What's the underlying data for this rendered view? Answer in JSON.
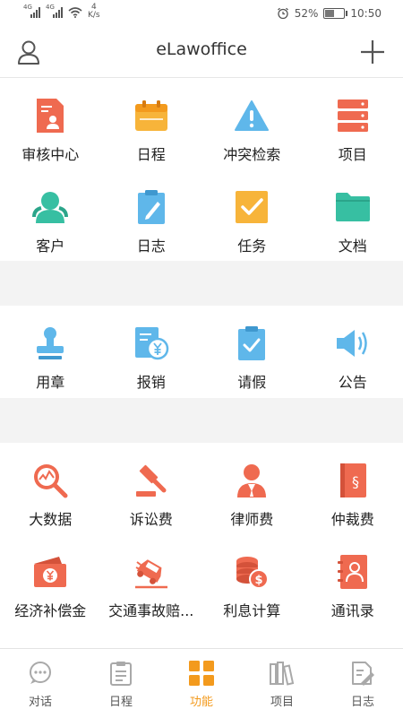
{
  "status_bar": {
    "net1": "4G",
    "net2": "4G",
    "speed_value": "4",
    "speed_unit": "K/s",
    "battery": "52%",
    "time": "10:50",
    "battery_level": 0.52
  },
  "header": {
    "title": "eLawoffice"
  },
  "sections": [
    {
      "items": [
        {
          "label": "审核中心",
          "icon": "review-document-icon"
        },
        {
          "label": "日程",
          "icon": "calendar-icon"
        },
        {
          "label": "冲突检索",
          "icon": "warning-triangle-icon"
        },
        {
          "label": "项目",
          "icon": "server-stack-icon"
        },
        {
          "label": "客户",
          "icon": "clients-icon"
        },
        {
          "label": "日志",
          "icon": "clipboard-pen-icon"
        },
        {
          "label": "任务",
          "icon": "checkbox-icon"
        },
        {
          "label": "文档",
          "icon": "folder-icon"
        }
      ]
    },
    {
      "items": [
        {
          "label": "用章",
          "icon": "stamp-icon"
        },
        {
          "label": "报销",
          "icon": "reimburse-yen-icon"
        },
        {
          "label": "请假",
          "icon": "leave-clipboard-icon"
        },
        {
          "label": "公告",
          "icon": "speaker-icon"
        }
      ]
    },
    {
      "items": [
        {
          "label": "大数据",
          "icon": "data-search-icon"
        },
        {
          "label": "诉讼费",
          "icon": "gavel-icon"
        },
        {
          "label": "律师费",
          "icon": "lawyer-icon"
        },
        {
          "label": "仲裁费",
          "icon": "law-book-icon"
        },
        {
          "label": "经济补偿金",
          "icon": "money-wallet-icon"
        },
        {
          "label": "交通事故赔...",
          "icon": "car-accident-icon"
        },
        {
          "label": "利息计算",
          "icon": "coins-icon"
        },
        {
          "label": "通讯录",
          "icon": "address-book-icon"
        }
      ]
    }
  ],
  "tabs": [
    {
      "label": "对话",
      "icon": "chat-bubble-icon",
      "active": false
    },
    {
      "label": "日程",
      "icon": "schedule-icon",
      "active": false
    },
    {
      "label": "功能",
      "icon": "grid-icon",
      "active": true
    },
    {
      "label": "项目",
      "icon": "books-icon",
      "active": false
    },
    {
      "label": "日志",
      "icon": "log-icon",
      "active": false
    }
  ],
  "colors": {
    "accent": "#f39a1d",
    "red": "#ef6a50",
    "yellow": "#f7b43a",
    "teal": "#37bfa2",
    "blue": "#5fb7ea",
    "gap": "#f3f3f3"
  }
}
